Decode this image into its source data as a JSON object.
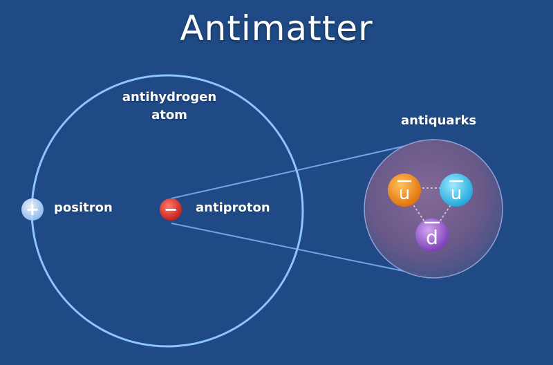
{
  "title": "Antimatter",
  "labels": {
    "atom_line1": "antihydrogen",
    "atom_line2": "atom",
    "positron": "positron",
    "antiproton": "antiproton",
    "antiquarks": "antiquarks"
  },
  "particles": {
    "positron_symbol": "+",
    "antiproton_symbol": "−"
  },
  "quarks": [
    {
      "symbol": "u",
      "color": "#f08a1c",
      "icon": "orange-anti-up-quark"
    },
    {
      "symbol": "u",
      "color": "#3cc4ea",
      "icon": "cyan-anti-up-quark"
    },
    {
      "symbol": "d",
      "color": "#9457c9",
      "icon": "purple-anti-down-quark"
    }
  ],
  "colors": {
    "background": "#1f4a85",
    "orbit": "#8ec4ff",
    "antiproton": "#e8332c",
    "nucleus_fill": "#6a5a8c"
  }
}
